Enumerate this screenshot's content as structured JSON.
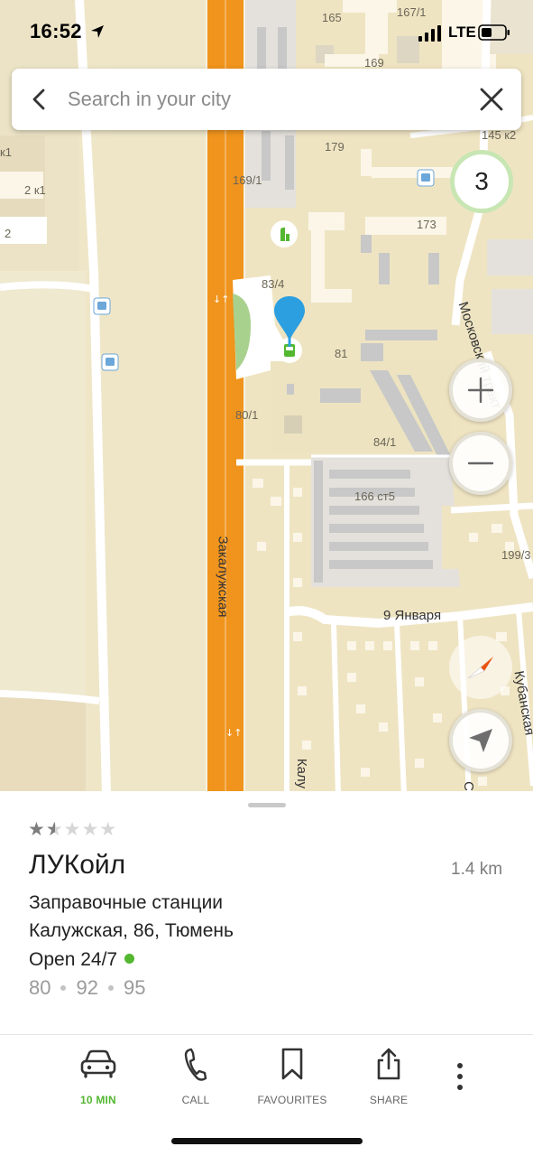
{
  "status_bar": {
    "time": "16:52",
    "network": "LTE"
  },
  "search": {
    "placeholder": "Search in your city"
  },
  "map": {
    "cluster_count": "3",
    "house_numbers": [
      "165",
      "167/1",
      "169",
      "145 к2",
      "179",
      "169/1",
      "173",
      "83/4",
      "81",
      "80/1",
      "84/1",
      "166 ст5",
      "199/3",
      "к1",
      "2 к1",
      "2"
    ],
    "streets": {
      "zakaluzhskaya": "Закалужская",
      "moskovsky": "Московский тракт",
      "january9": "9 Января",
      "kubanskaya": "Кубанская",
      "kaluzhskaya": "Калу",
      "partial_s": "С"
    },
    "colors": {
      "background": "#efe6c8",
      "highway": "#f0941d",
      "pin": "#2b9fe0",
      "fuel": "#53b730"
    }
  },
  "place": {
    "rating_stars": "★★★★★",
    "rating_value": 1.5,
    "name": "ЛУКойл",
    "distance": "1.4 km",
    "category": "Заправочные станции",
    "address": "Калужская, 86, Тюмень",
    "hours": "Open 24/7",
    "fuels": [
      "80",
      "92",
      "95"
    ]
  },
  "toolbar": {
    "route_label": "10 MIN",
    "call_label": "CALL",
    "favourites_label": "FAVOURITES",
    "share_label": "SHARE"
  }
}
